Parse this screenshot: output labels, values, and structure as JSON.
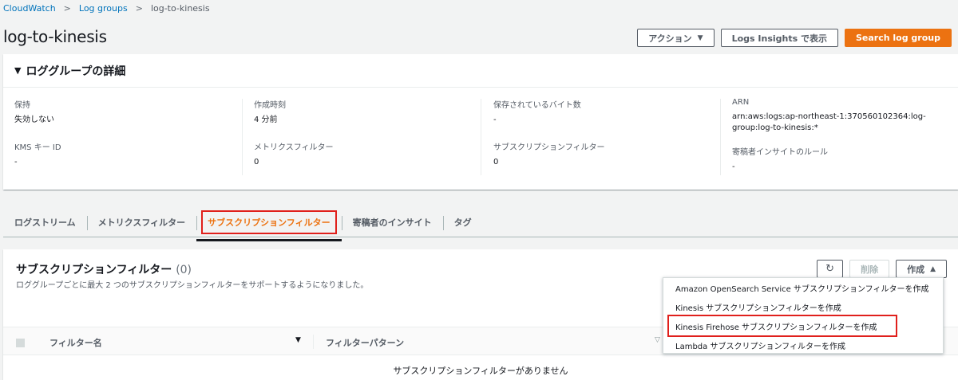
{
  "breadcrumb": {
    "items": [
      "CloudWatch",
      "Log groups"
    ],
    "current": "log-to-kinesis"
  },
  "page": {
    "title": "log-to-kinesis"
  },
  "header_buttons": {
    "actions": "アクション",
    "insights": "Logs Insights で表示",
    "search": "Search log group"
  },
  "details": {
    "heading": "ロググループの詳細",
    "retention": {
      "label": "保持",
      "value": "失効しない"
    },
    "kms": {
      "label": "KMS キー ID",
      "value": "-"
    },
    "created": {
      "label": "作成時刻",
      "value": "4 分前"
    },
    "metric_filters": {
      "label": "メトリクスフィルター",
      "value": "0"
    },
    "stored_bytes": {
      "label": "保存されているバイト数",
      "value": "-"
    },
    "subscription_filters": {
      "label": "サブスクリプションフィルター",
      "value": "0"
    },
    "arn": {
      "label": "ARN",
      "value_line1": "arn:aws:logs:ap-northeast-1:370560102364:log-",
      "value_line2": "group:log-to-kinesis:*"
    },
    "contributor": {
      "label": "寄稿者インサイトのルール",
      "value": "-"
    }
  },
  "tabs": [
    "ログストリーム",
    "メトリクスフィルター",
    "サブスクリプションフィルター",
    "寄稿者のインサイト",
    "タグ"
  ],
  "active_tab_index": 2,
  "panel": {
    "title": "サブスクリプションフィルター",
    "count": "(0)",
    "description": "ロググループごとに最大 2 つのサブスクリプションフィルターをサポートするようになりました。",
    "delete_label": "削除",
    "create_label": "作成",
    "refresh_icon": "refresh-icon"
  },
  "table": {
    "columns": [
      "フィルター名",
      "フィルターパターン"
    ],
    "empty_text": "サブスクリプションフィルターがありません"
  },
  "create_menu": {
    "items": [
      "Amazon OpenSearch Service サブスクリプションフィルターを作成",
      "Kinesis サブスクリプションフィルターを作成",
      "Kinesis Firehose サブスクリプションフィルターを作成",
      "Lambda サブスクリプションフィルターを作成"
    ],
    "highlighted_index": 2
  },
  "colors": {
    "accent": "#ec7211",
    "link": "#0073bb",
    "highlight_box": "#e0201c"
  }
}
